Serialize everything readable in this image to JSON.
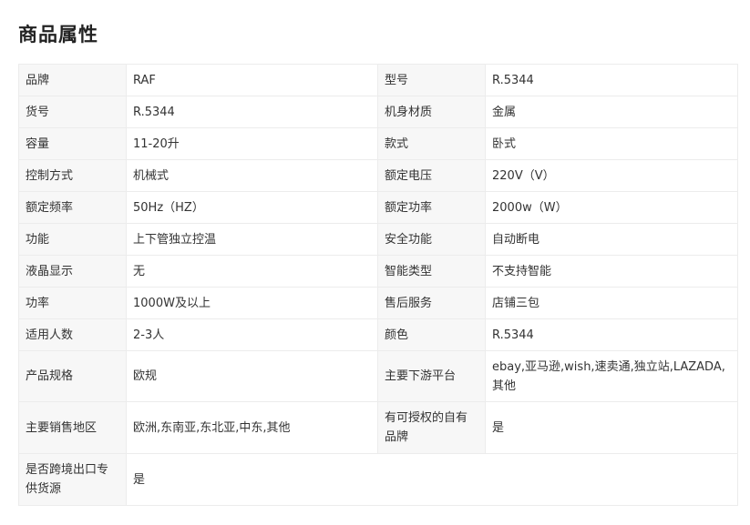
{
  "section": {
    "title": "商品属性"
  },
  "attributes": {
    "rows": [
      {
        "k1": "品牌",
        "v1": "RAF",
        "k2": "型号",
        "v2": "R.5344"
      },
      {
        "k1": "货号",
        "v1": "R.5344",
        "k2": "机身材质",
        "v2": "金属"
      },
      {
        "k1": "容量",
        "v1": "11-20升",
        "k2": "款式",
        "v2": "卧式"
      },
      {
        "k1": "控制方式",
        "v1": "机械式",
        "k2": "额定电压",
        "v2": "220V（V）"
      },
      {
        "k1": "额定频率",
        "v1": "50Hz（HZ）",
        "k2": "额定功率",
        "v2": "2000w（W）"
      },
      {
        "k1": "功能",
        "v1": "上下管独立控温",
        "k2": "安全功能",
        "v2": "自动断电"
      },
      {
        "k1": "液晶显示",
        "v1": "无",
        "k2": "智能类型",
        "v2": "不支持智能"
      },
      {
        "k1": "功率",
        "v1": "1000W及以上",
        "k2": "售后服务",
        "v2": "店铺三包"
      },
      {
        "k1": "适用人数",
        "v1": "2-3人",
        "k2": "颜色",
        "v2": "R.5344"
      },
      {
        "k1": "产品规格",
        "v1": "欧规",
        "k2": "主要下游平台",
        "v2": "ebay,亚马逊,wish,速卖通,独立站,LAZADA,其他"
      },
      {
        "k1": "主要销售地区",
        "v1": "欧洲,东南亚,东北亚,中东,其他",
        "k2": "有可授权的自有品牌",
        "v2": "是"
      },
      {
        "k1": "是否跨境出口专供货源",
        "v1": "是"
      }
    ]
  }
}
